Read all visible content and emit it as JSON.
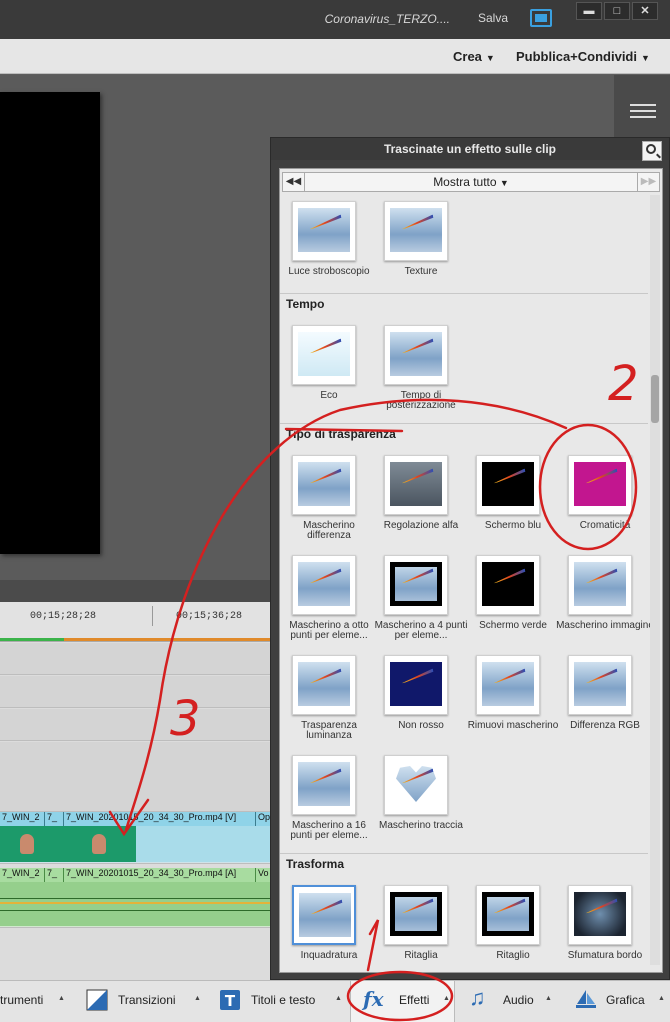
{
  "titlebar": {
    "project_name": "Coronavirus_TERZO....",
    "save_label": "Salva",
    "window_buttons": [
      "▬",
      "□",
      "✕"
    ]
  },
  "menubar": {
    "create_label": "Crea",
    "publish_label": "Pubblica+Condividi"
  },
  "timeline": {
    "timecodes": [
      "00;15;28;28",
      "00;15;36;28"
    ],
    "video_clips": [
      {
        "label": "7_WIN_2"
      },
      {
        "label": "7_"
      },
      {
        "label": "7_WIN_20201015_20_34_30_Pro.mp4 [V]"
      },
      {
        "label": "Op"
      }
    ],
    "audio_clips": [
      {
        "label": "7_WIN_2"
      },
      {
        "label": "7_"
      },
      {
        "label": "7_WIN_20201015_20_34_30_Pro.mp4 [A]"
      },
      {
        "label": "Vo"
      }
    ]
  },
  "effects_panel": {
    "title": "Trascinate un effetto sulle clip",
    "filter_value": "Mostra tutto",
    "top_items": [
      {
        "label": "Luce stroboscopio",
        "style": "normal"
      },
      {
        "label": "Texture",
        "style": "normal"
      }
    ],
    "sections": [
      {
        "name": "Tempo",
        "items": [
          {
            "label": "Eco",
            "style": "echo"
          },
          {
            "label": "Tempo di posterizzazione",
            "style": "normal"
          }
        ]
      },
      {
        "name": "Tipo di trasparenza",
        "items": [
          {
            "label": "Mascherino differenza",
            "style": "normal"
          },
          {
            "label": "Regolazione alfa",
            "style": "dark"
          },
          {
            "label": "Schermo blu",
            "style": "black"
          },
          {
            "label": "Cromaticità",
            "style": "magenta"
          },
          {
            "label": "Mascherino a otto punti per eleme...",
            "style": "wavy"
          },
          {
            "label": "Mascherino a 4 punti per eleme...",
            "style": "blackframe"
          },
          {
            "label": "Schermo verde",
            "style": "black"
          },
          {
            "label": "Mascherino immagine",
            "style": "wavy"
          },
          {
            "label": "Trasparenza luminanza",
            "style": "normal"
          },
          {
            "label": "Non rosso",
            "style": "navy"
          },
          {
            "label": "Rimuovi mascherino",
            "style": "normal"
          },
          {
            "label": "Differenza RGB",
            "style": "wavy"
          },
          {
            "label": "Mascherino a 16 punti per eleme...",
            "style": "wavy"
          },
          {
            "label": "Mascherino traccia",
            "style": "heart"
          }
        ]
      },
      {
        "name": "Trasforma",
        "items": [
          {
            "label": "Inquadratura",
            "style": "selected"
          },
          {
            "label": "Ritaglia",
            "style": "blackframe"
          },
          {
            "label": "Ritaglio",
            "style": "blackframe"
          },
          {
            "label": "Sfumatura bordo",
            "style": "vignette"
          }
        ]
      }
    ]
  },
  "bottombar": {
    "tools_label": "trumenti",
    "transitions_label": "Transizioni",
    "titles_label": "Titoli e testo",
    "effects_label": "Effetti",
    "audio_label": "Audio",
    "graphics_label": "Grafica"
  },
  "annotations": {
    "numbers": [
      "1",
      "2",
      "3"
    ],
    "color": "#d42020"
  }
}
